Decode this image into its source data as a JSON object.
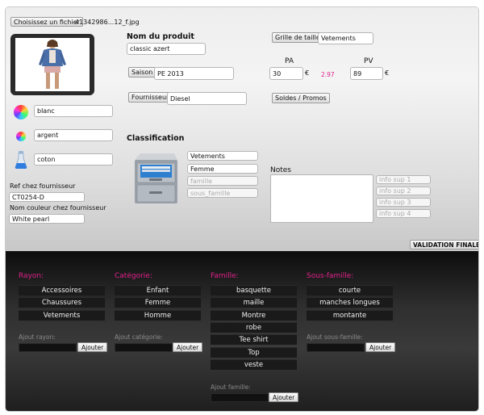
{
  "upload": {
    "button_label": "Choisissez un fichier",
    "file_name": "41342986...12_f.jpg"
  },
  "product": {
    "name_label": "Nom du produit",
    "name_value": "classic azert",
    "season_button": "Saison",
    "season_value": "PE 2013",
    "supplier_button": "Fournisseur",
    "supplier_value": "Diesel",
    "size_grid_button": "Grille de taille",
    "size_grid_value": "Vetements",
    "pa_label": "PA",
    "pa_value": "30",
    "currency": "€",
    "margin_value": "2.97",
    "pv_label": "PV",
    "pv_value": "89",
    "sales_button": "Soldes / Promos"
  },
  "attributes": {
    "color_value": "blanc",
    "color2_value": "argent",
    "material_value": "coton",
    "supplier_ref_label": "Ref chez fournisseur",
    "supplier_ref_value": "CT0254-D",
    "supplier_color_label": "Nom couleur chez fournisseur",
    "supplier_color_value": "White pearl"
  },
  "classification": {
    "title": "Classification",
    "fields": [
      {
        "value": "Vetements",
        "placeholder": false
      },
      {
        "value": "Femme",
        "placeholder": false
      },
      {
        "value": "famille",
        "placeholder": true
      },
      {
        "value": "sous_famille",
        "placeholder": true
      }
    ]
  },
  "notes": {
    "label": "Notes",
    "info": [
      "info sup 1",
      "info sup 2",
      "info sup 3",
      "info sup 4"
    ]
  },
  "validate_button": "VALIDATION FINALE",
  "columns": [
    {
      "title": "Rayon:",
      "items": [
        "Accessoires",
        "Chaussures",
        "Vetements"
      ],
      "add_label": "Ajout rayon:",
      "add_button": "Ajouter"
    },
    {
      "title": "Catégorie:",
      "items": [
        "Enfant",
        "Femme",
        "Homme"
      ],
      "add_label": "Ajout catégorie:",
      "add_button": "Ajouter"
    },
    {
      "title": "Famille:",
      "items": [
        "basquette",
        "maille",
        "Montre",
        "robe",
        "Tee shirt",
        "Top",
        "veste"
      ],
      "add_label": "Ajout famille:",
      "add_button": "Ajouter"
    },
    {
      "title": "Sous-famille:",
      "items": [
        "courte",
        "manches longues",
        "montante"
      ],
      "add_label": "Ajout sous-famille:",
      "add_button": "Ajouter"
    }
  ],
  "colors": {
    "accent": "#e0208a",
    "dark_bg": "#2f2f2f"
  },
  "icons": [
    "color-wheel-icon",
    "color-wheel-small-icon",
    "flask-icon",
    "filing-cabinet-icon"
  ]
}
